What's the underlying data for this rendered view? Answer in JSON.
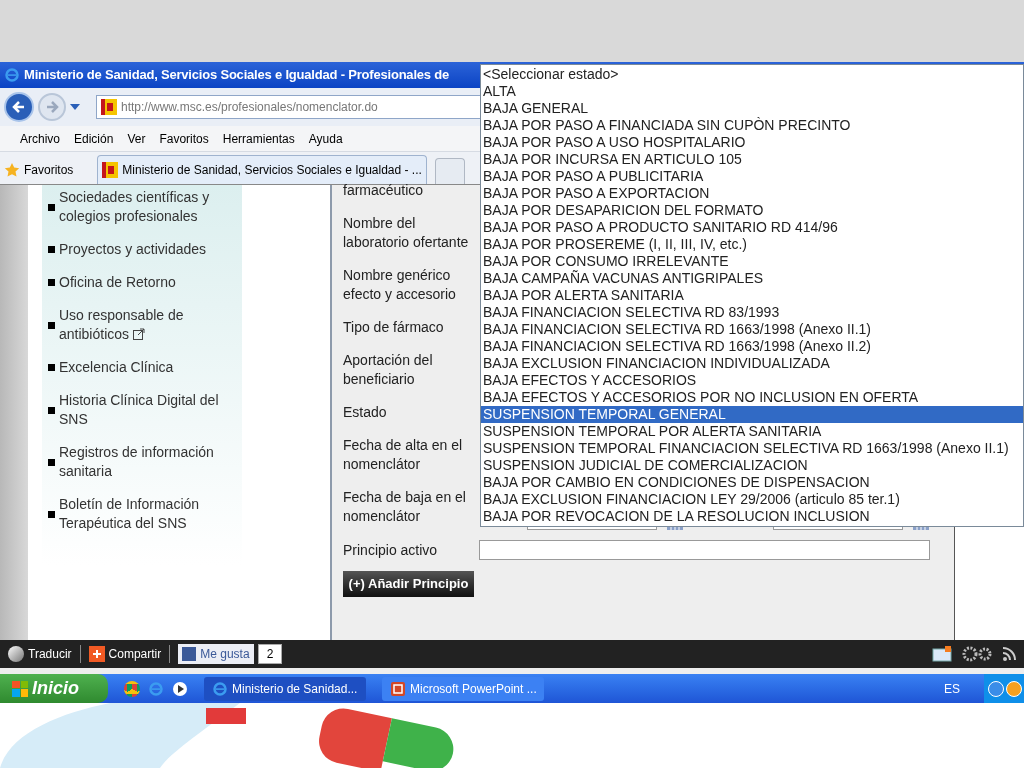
{
  "window": {
    "title": "Ministerio de Sanidad, Servicios Sociales e Igualdad - Profesionales de"
  },
  "address_bar": {
    "url": "http://www.msc.es/profesionales/nomenclator.do"
  },
  "menu": [
    "Archivo",
    "Edición",
    "Ver",
    "Favoritos",
    "Herramientas",
    "Ayuda"
  ],
  "favorites_bar": {
    "label": "Favoritos",
    "tabs": [
      {
        "label": "Ministerio de Sanidad, Servicios Sociales e Igualdad - ...",
        "selected": true
      }
    ]
  },
  "sidebar": {
    "items": [
      {
        "label": "Sociedades científicas y colegios profesionales",
        "external": false
      },
      {
        "label": "Proyectos y actividades",
        "external": false
      },
      {
        "label": "Oficina de Retorno",
        "external": false
      },
      {
        "label": "Uso responsable de antibióticos",
        "external": true
      },
      {
        "label": "Excelencia Clínica",
        "external": false
      },
      {
        "label": "Historia Clínica Digital del SNS",
        "external": false
      },
      {
        "label": "Registros de información sanitaria",
        "external": false
      },
      {
        "label": "Boletín de Información Terapéutica del SNS",
        "external": false
      }
    ]
  },
  "form": {
    "rows": [
      {
        "label": "farmacéutico",
        "kind": "plain"
      },
      {
        "label": "Nombre del laboratorio ofertante",
        "kind": "plain"
      },
      {
        "label": "Nombre genérico efecto y accesorio",
        "kind": "plain"
      },
      {
        "label": "Tipo de fármaco",
        "kind": "plain"
      },
      {
        "label": "Aportación del beneficiario",
        "kind": "plain"
      },
      {
        "label": "Estado",
        "kind": "plain"
      },
      {
        "label": "Fecha de alta en el nomenclátor",
        "kind": "plain"
      },
      {
        "label": "Fecha de baja en el nomenclátor",
        "kind": "date_range"
      },
      {
        "label": "Principio activo",
        "kind": "text"
      }
    ],
    "button": "(+) Añadir Principio"
  },
  "dropdown": {
    "options": [
      {
        "label": "<Seleccionar estado>",
        "selected": false
      },
      {
        "label": "ALTA",
        "selected": false
      },
      {
        "label": "BAJA GENERAL",
        "selected": false
      },
      {
        "label": "BAJA POR PASO A FINANCIADA SIN CUPÒN PRECINTO",
        "selected": false
      },
      {
        "label": "BAJA POR PASO A USO HOSPITALARIO",
        "selected": false
      },
      {
        "label": "BAJA POR INCURSA EN ARTICULO 105",
        "selected": false
      },
      {
        "label": "BAJA POR PASO A PUBLICITARIA",
        "selected": false
      },
      {
        "label": "BAJA POR PASO A EXPORTACION",
        "selected": false
      },
      {
        "label": "BAJA POR DESAPARICION DEL FORMATO",
        "selected": false
      },
      {
        "label": "BAJA POR PASO A PRODUCTO SANITARIO RD 414/96",
        "selected": false
      },
      {
        "label": "BAJA POR PROSEREME (I, II, III, IV, etc.)",
        "selected": false
      },
      {
        "label": "BAJA POR CONSUMO IRRELEVANTE",
        "selected": false
      },
      {
        "label": "BAJA CAMPAÑA VACUNAS ANTIGRIPALES",
        "selected": false
      },
      {
        "label": "BAJA POR ALERTA SANITARIA",
        "selected": false
      },
      {
        "label": "BAJA FINANCIACION SELECTIVA RD 83/1993",
        "selected": false
      },
      {
        "label": "BAJA FINANCIACION SELECTIVA RD 1663/1998 (Anexo II.1)",
        "selected": false
      },
      {
        "label": "BAJA FINANCIACION SELECTIVA RD 1663/1998 (Anexo II.2)",
        "selected": false
      },
      {
        "label": "BAJA EXCLUSION FINANCIACION INDIVIDUALIZADA",
        "selected": false
      },
      {
        "label": "BAJA EFECTOS Y ACCESORIOS",
        "selected": false
      },
      {
        "label": "BAJA EFECTOS Y ACCESORIOS POR NO INCLUSION EN OFERTA",
        "selected": false
      },
      {
        "label": "SUSPENSION TEMPORAL GENERAL",
        "selected": true
      },
      {
        "label": "SUSPENSION TEMPORAL POR ALERTA SANITARIA",
        "selected": false
      },
      {
        "label": "SUSPENSION TEMPORAL FINANCIACION SELECTIVA RD 1663/1998 (Anexo II.1)",
        "selected": false
      },
      {
        "label": "SUSPENSION JUDICIAL DE COMERCIALIZACION",
        "selected": false
      },
      {
        "label": "BAJA POR CAMBIO EN CONDICIONES DE DISPENSACION",
        "selected": false
      },
      {
        "label": "BAJA EXCLUSION FINANCIACION LEY 29/2006 (articulo 85 ter.1)",
        "selected": false
      },
      {
        "label": "BAJA POR REVOCACION DE LA RESOLUCION INCLUSION",
        "selected": false
      }
    ]
  },
  "toolbar": {
    "translate": "Traducir",
    "share": "Compartir",
    "like": "Me gusta",
    "like_count": "2"
  },
  "taskbar": {
    "start": "Inicio",
    "windows": [
      {
        "label": "Ministerio de Sanidad...",
        "kind": "browser"
      },
      {
        "label": "Microsoft PowerPoint ...",
        "kind": "presentation"
      }
    ],
    "language": "ES"
  }
}
